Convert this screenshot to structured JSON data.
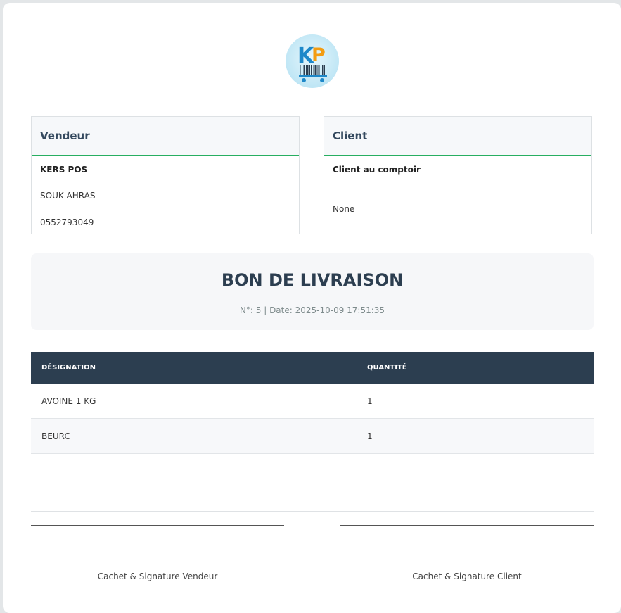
{
  "logo": {
    "text": "KP",
    "icon": "barcode-cart-logo"
  },
  "seller": {
    "heading": "Vendeur",
    "name": "KERS POS",
    "city": "SOUK AHRAS",
    "phone": "0552793049"
  },
  "client": {
    "heading": "Client",
    "name": "Client au comptoir",
    "info": "None"
  },
  "document": {
    "title": "BON DE LIVRAISON",
    "number_label": "N°: 5",
    "separator": " | ",
    "date_label": "Date: 2025-10-09 17:51:35"
  },
  "items_table": {
    "headers": [
      "DÉSIGNATION",
      "QUANTITÉ"
    ],
    "rows": [
      {
        "designation": "AVOINE 1 KG",
        "quantite": "1"
      },
      {
        "designation": "BEURC",
        "quantite": "1"
      }
    ]
  },
  "signatures": {
    "seller_label": "Cachet & Signature Vendeur",
    "client_label": "Cachet & Signature Client"
  },
  "colors": {
    "header_dark": "#2c3e50",
    "accent_green": "#27ae60"
  }
}
